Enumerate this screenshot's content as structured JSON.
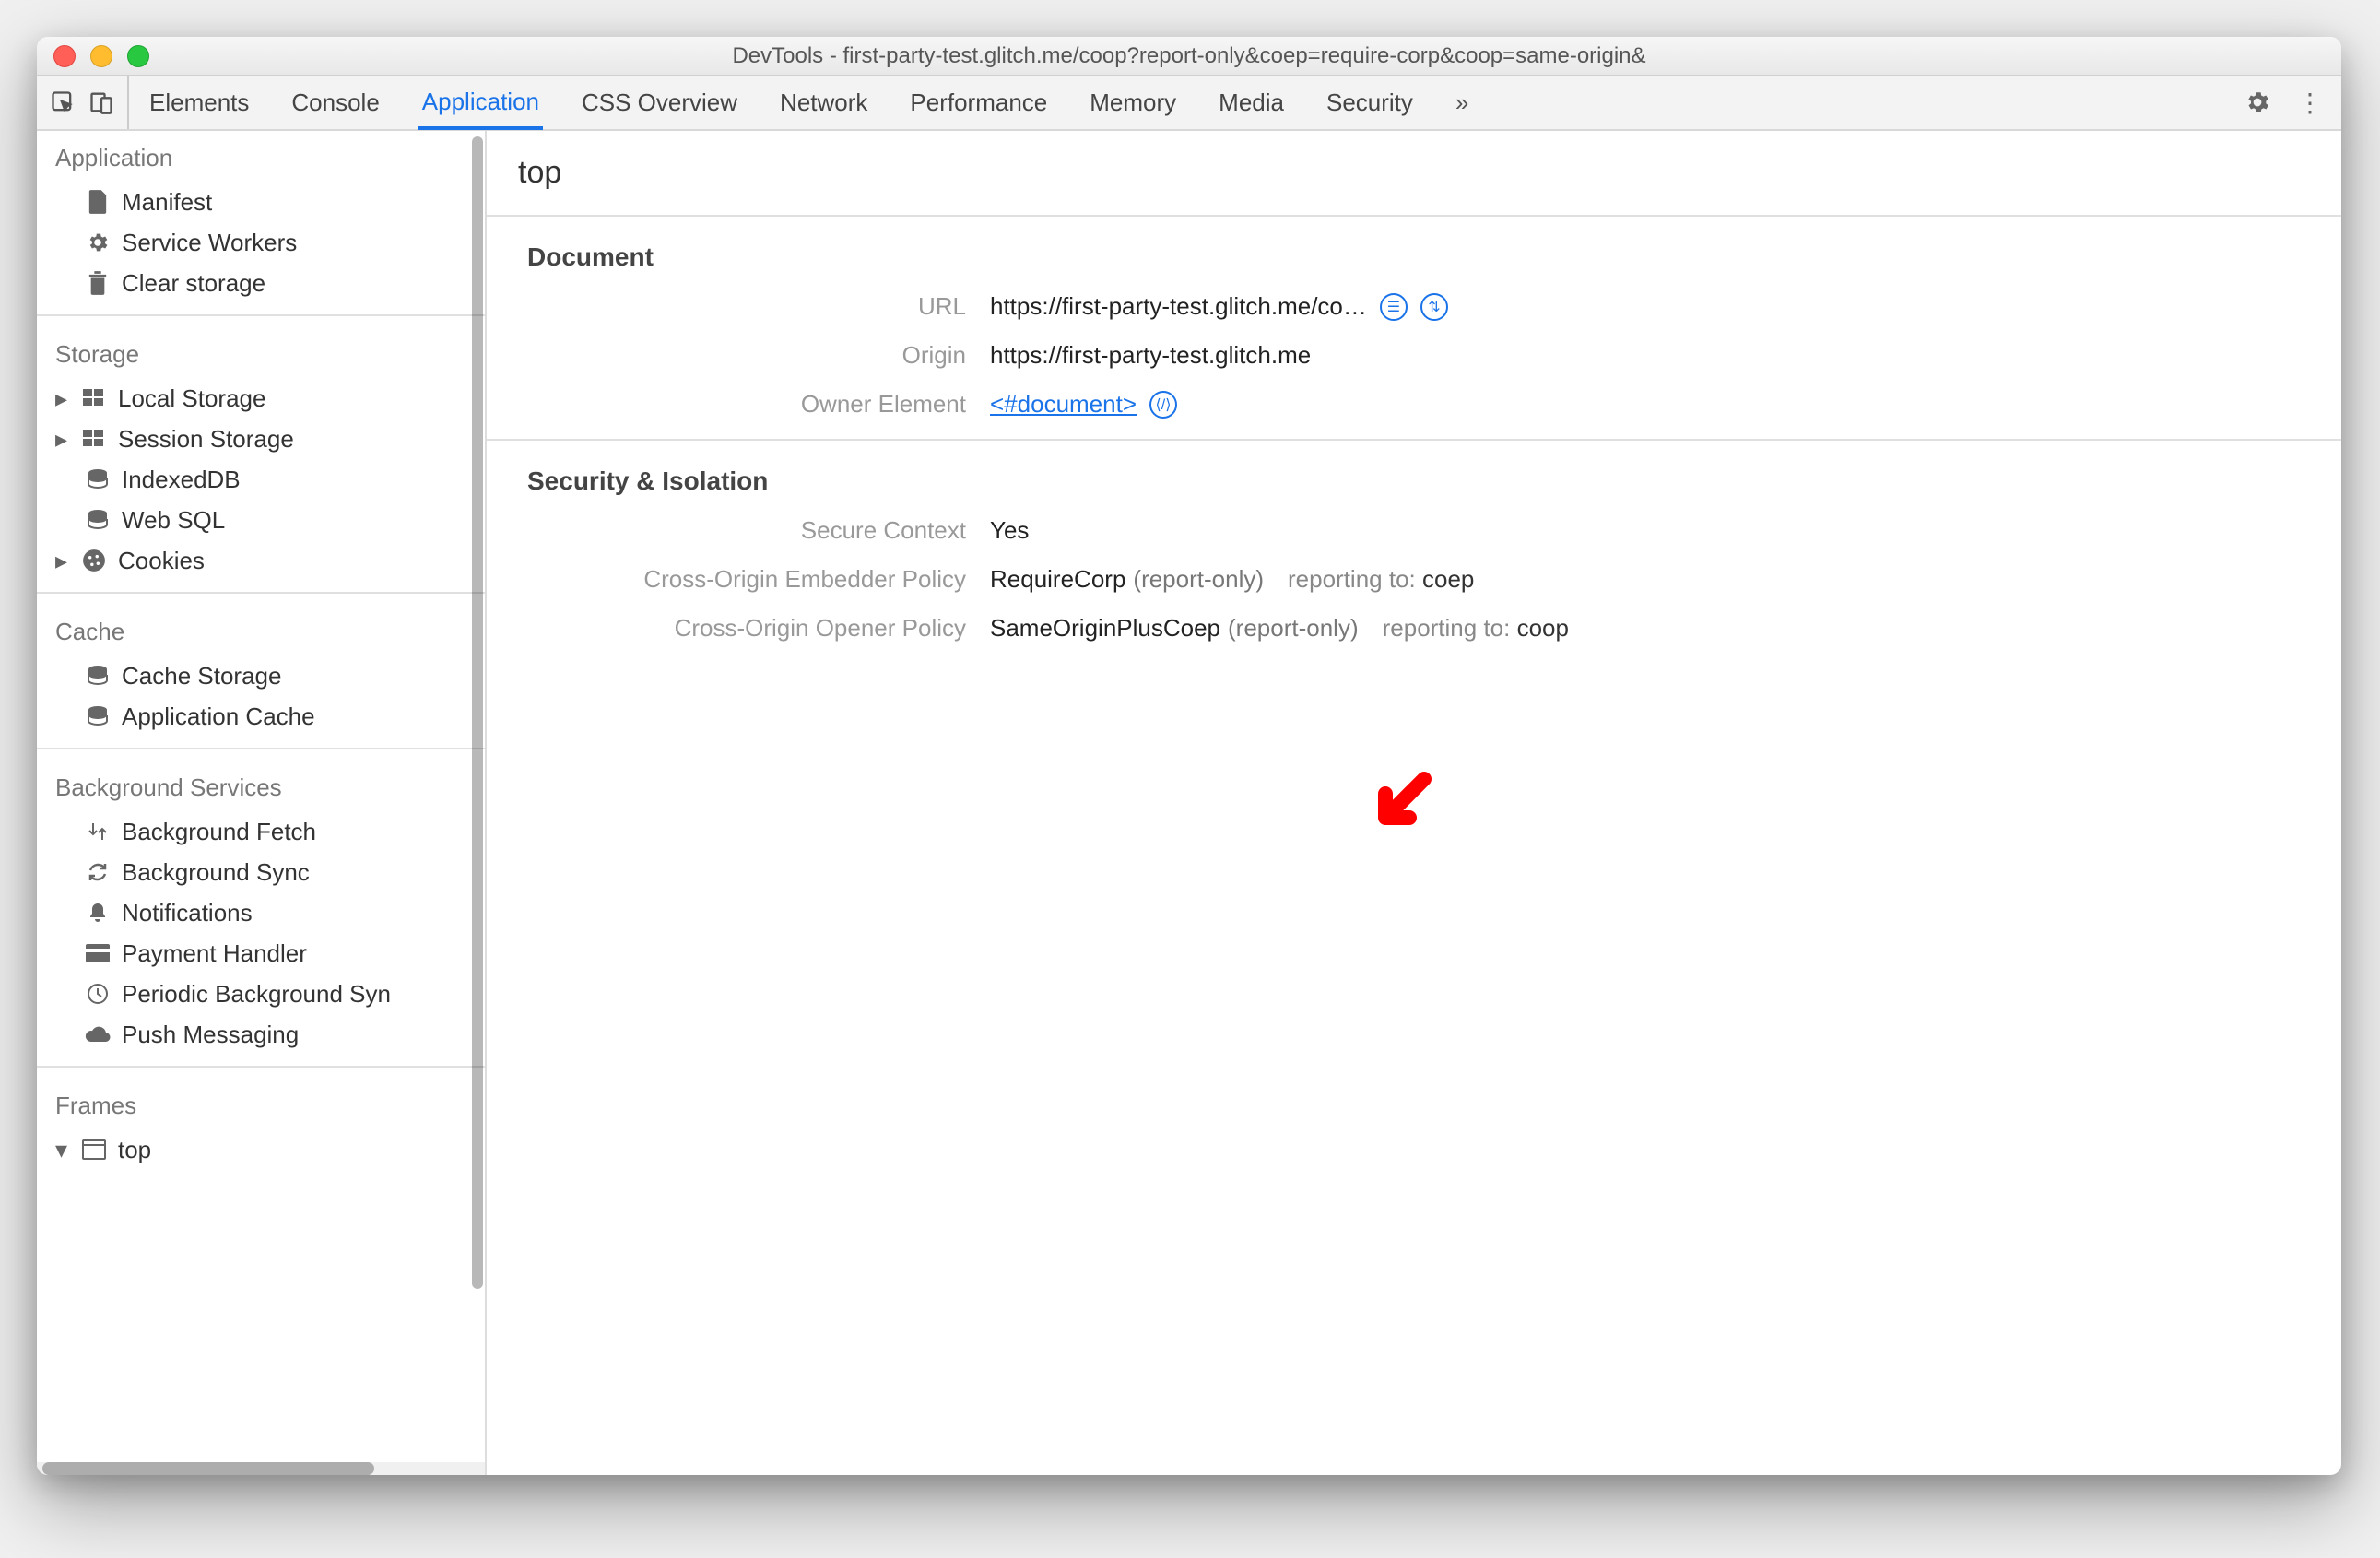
{
  "window": {
    "title": "DevTools - first-party-test.glitch.me/coop?report-only&coep=require-corp&coop=same-origin&"
  },
  "tabs": {
    "items": [
      "Elements",
      "Console",
      "Application",
      "CSS Overview",
      "Network",
      "Performance",
      "Memory",
      "Media",
      "Security"
    ],
    "active": "Application",
    "overflow_glyph": "»"
  },
  "sidebar": {
    "groups": [
      {
        "title": "Application",
        "items": [
          {
            "icon": "file-icon",
            "label": "Manifest"
          },
          {
            "icon": "gear-icon",
            "label": "Service Workers"
          },
          {
            "icon": "trash-icon",
            "label": "Clear storage"
          }
        ]
      },
      {
        "title": "Storage",
        "items": [
          {
            "expandable": true,
            "icon": "grid-icon",
            "label": "Local Storage"
          },
          {
            "expandable": true,
            "icon": "grid-icon",
            "label": "Session Storage"
          },
          {
            "icon": "db-icon",
            "label": "IndexedDB"
          },
          {
            "icon": "db-icon",
            "label": "Web SQL"
          },
          {
            "expandable": true,
            "icon": "cookie-icon",
            "label": "Cookies"
          }
        ]
      },
      {
        "title": "Cache",
        "items": [
          {
            "icon": "db-icon",
            "label": "Cache Storage"
          },
          {
            "icon": "db-icon",
            "label": "Application Cache"
          }
        ]
      },
      {
        "title": "Background Services",
        "items": [
          {
            "icon": "updown-icon",
            "label": "Background Fetch"
          },
          {
            "icon": "sync-icon",
            "label": "Background Sync"
          },
          {
            "icon": "bell-icon",
            "label": "Notifications"
          },
          {
            "icon": "card-icon",
            "label": "Payment Handler"
          },
          {
            "icon": "clock-icon",
            "label": "Periodic Background Syn"
          },
          {
            "icon": "cloud-icon",
            "label": "Push Messaging"
          }
        ]
      },
      {
        "title": "Frames",
        "items": [
          {
            "expandable": true,
            "expanded": true,
            "icon": "window-icon",
            "label": "top"
          }
        ]
      }
    ]
  },
  "main": {
    "heading": "top",
    "document": {
      "section_title": "Document",
      "url_label": "URL",
      "url_value": "https://first-party-test.glitch.me/co…",
      "origin_label": "Origin",
      "origin_value": "https://first-party-test.glitch.me",
      "owner_label": "Owner Element",
      "owner_link": "<#document>"
    },
    "security": {
      "section_title": "Security & Isolation",
      "secure_label": "Secure Context",
      "secure_value": "Yes",
      "coep_label": "Cross-Origin Embedder Policy",
      "coep_value": "RequireCorp",
      "coep_mode": "(report-only)",
      "coep_reporting_prefix": "reporting to: ",
      "coep_reporting_target": "coep",
      "coop_label": "Cross-Origin Opener Policy",
      "coop_value": "SameOriginPlusCoep",
      "coop_mode": "(report-only)",
      "coop_reporting_prefix": "reporting to: ",
      "coop_reporting_target": "coop"
    }
  }
}
